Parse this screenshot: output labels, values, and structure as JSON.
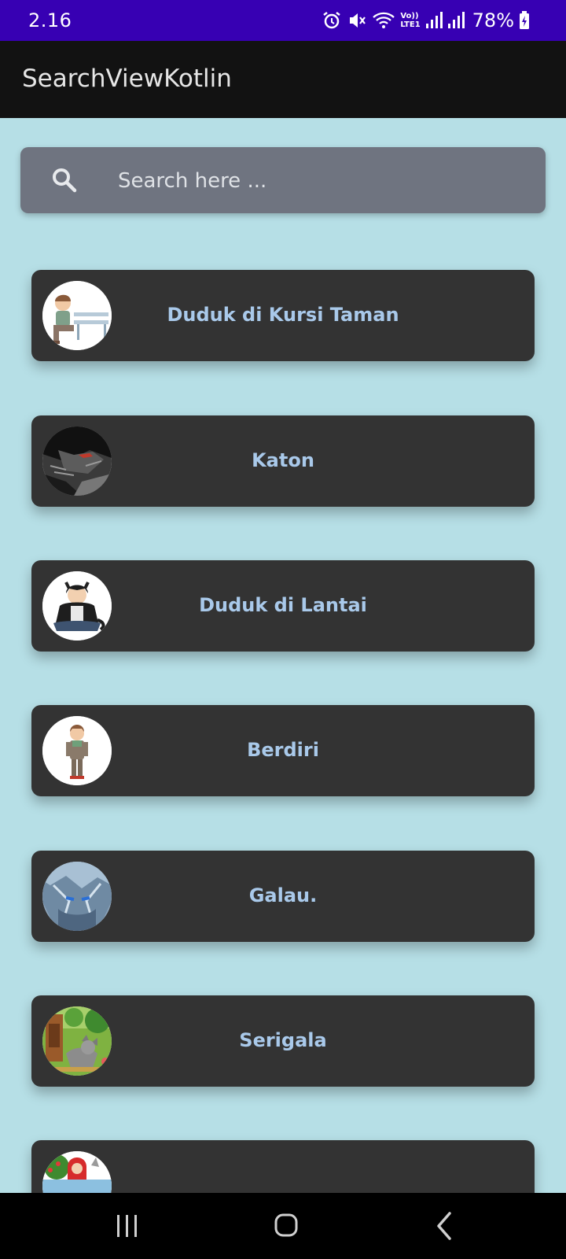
{
  "status_bar": {
    "time": "2.16",
    "battery_percent": "78%",
    "network_label_top": "Vo))",
    "network_label_bottom": "LTE1",
    "icons": [
      "alarm-icon",
      "mute-icon",
      "wifi-icon",
      "volte-icon",
      "signal-icon",
      "signal-icon",
      "battery-charging-icon"
    ]
  },
  "app_bar": {
    "title": "SearchViewKotlin"
  },
  "search": {
    "placeholder": "Search here ...",
    "value": "",
    "icon": "search-icon"
  },
  "list": {
    "items": [
      {
        "title": "Duduk di Kursi Taman",
        "avatar": "boy-on-bench-image"
      },
      {
        "title": "Katon",
        "avatar": "dark-anime-image"
      },
      {
        "title": "Duduk di Lantai",
        "avatar": "boy-sitting-floor-image"
      },
      {
        "title": "Berdiri",
        "avatar": "boy-standing-image"
      },
      {
        "title": "Galau.",
        "avatar": "blue-anime-image"
      },
      {
        "title": "Serigala",
        "avatar": "wolf-forest-image"
      },
      {
        "title": "",
        "avatar": "red-riding-hood-image"
      }
    ]
  },
  "nav_bar": {
    "icons": [
      "recents-icon",
      "home-icon",
      "back-icon"
    ]
  },
  "colors": {
    "status_bar": "#3700b3",
    "app_bar": "#121212",
    "background": "#b6dfe6",
    "card": "#333333",
    "card_text": "#a9c9ea",
    "search_bg": "#6f7480"
  }
}
